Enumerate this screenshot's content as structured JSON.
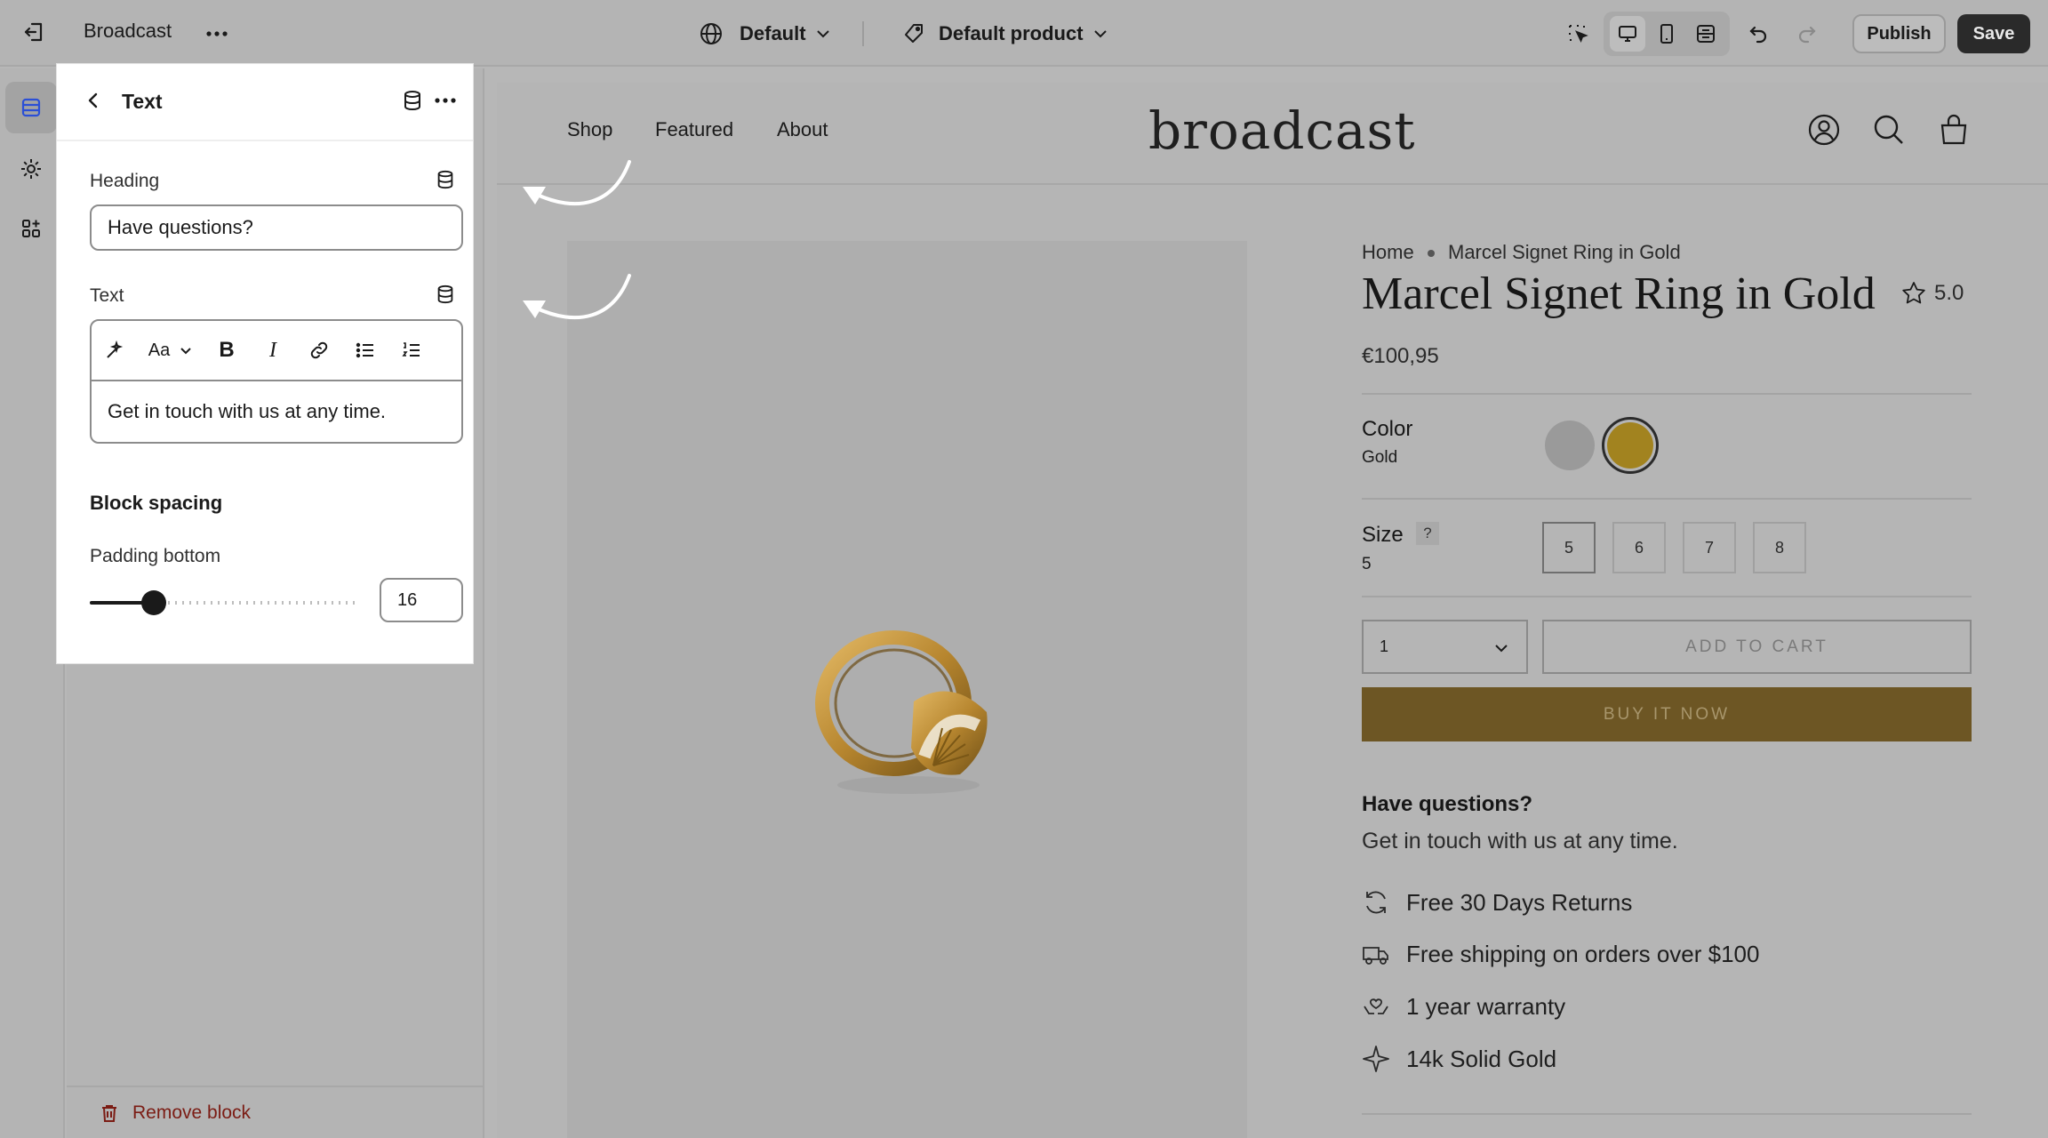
{
  "topbar": {
    "store_name": "Broadcast",
    "theme_selector": "Default",
    "template_selector": "Default product",
    "publish_label": "Publish",
    "save_label": "Save"
  },
  "panel": {
    "title": "Text",
    "heading_label": "Heading",
    "heading_value": "Have questions?",
    "text_label": "Text",
    "text_value": "Get in touch with us at any time.",
    "block_spacing_label": "Block spacing",
    "padding_bottom_label": "Padding bottom",
    "padding_bottom_value": "16",
    "padding_bottom_fraction": 0.24,
    "remove_label": "Remove block"
  },
  "store": {
    "logo": "broadcast",
    "nav": [
      "Shop",
      "Featured",
      "About"
    ]
  },
  "product": {
    "breadcrumb_home": "Home",
    "breadcrumb_current": "Marcel Signet Ring in Gold",
    "title": "Marcel Signet Ring in Gold",
    "rating": "5.0",
    "price": "€100,95",
    "color_label": "Color",
    "color_value": "Gold",
    "color_swatches": [
      "#9a9a9a",
      "#a2831f"
    ],
    "size_label": "Size",
    "size_help": "?",
    "size_value": "5",
    "sizes": [
      "5",
      "6",
      "7",
      "8"
    ],
    "quantity": "1",
    "add_to_cart": "ADD TO CART",
    "buy_now": "BUY IT NOW",
    "questions_heading": "Have questions?",
    "questions_text": "Get in touch with us at any time.",
    "features": [
      "Free 30 Days Returns",
      "Free shipping on orders over $100",
      "1 year warranty",
      "14k Solid Gold"
    ]
  },
  "colors": {
    "accent_gold": "#6d5624",
    "save_bg": "#2a2a2a",
    "remove_text": "#7b1c14"
  }
}
